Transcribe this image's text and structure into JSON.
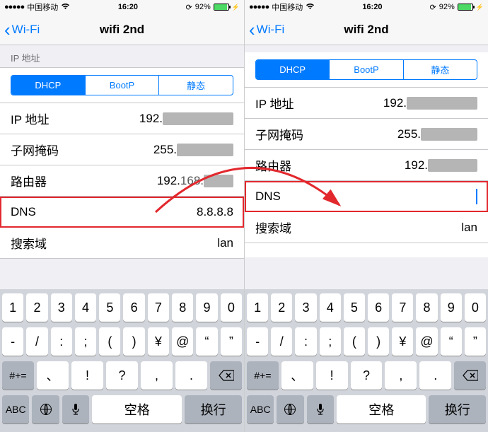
{
  "statusbar": {
    "carrier": "中国移动",
    "time": "16:20",
    "battery_pct": "92%"
  },
  "nav": {
    "back": "Wi-Fi",
    "title": "wifi 2nd"
  },
  "section_label": "IP 地址",
  "segments": {
    "dhcp": "DHCP",
    "bootp": "BootP",
    "static": "静态"
  },
  "rows": {
    "ip_label": "IP 地址",
    "ip_prefix": "192.",
    "subnet_label": "子网掩码",
    "subnet_prefix": "255.",
    "router_label": "路由器",
    "router_prefix": "192.",
    "dns_label": "DNS",
    "dns_value_left": "8.8.8.8",
    "search_label": "搜索域",
    "search_value": "lan"
  },
  "keyboard": {
    "r1": [
      "1",
      "2",
      "3",
      "4",
      "5",
      "6",
      "7",
      "8",
      "9",
      "0"
    ],
    "r2": [
      "-",
      "/",
      ":",
      ";",
      "(",
      ")",
      "¥",
      "@",
      "“",
      "”"
    ],
    "alt": "#+=",
    "r3": [
      ".",
      ",",
      "?",
      "!",
      "、"
    ],
    "abc": "ABC",
    "space": "空格",
    "return": "换行"
  }
}
